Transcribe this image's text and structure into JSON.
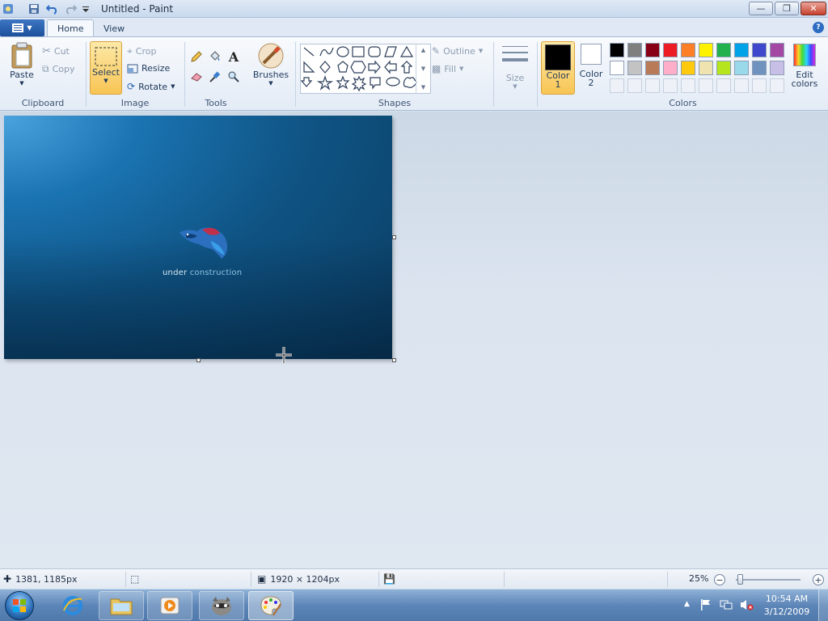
{
  "window": {
    "title": "Untitled - Paint",
    "controls": {
      "minimize_icon": "minimize-icon",
      "maximize_icon": "restore-icon",
      "close_icon": "close-icon"
    }
  },
  "quick_access": [
    "save-icon",
    "undo-icon",
    "redo-icon",
    "customize-dropdown-icon"
  ],
  "tabs": {
    "home": "Home",
    "view": "View"
  },
  "ribbon": {
    "clipboard": {
      "label": "Clipboard",
      "paste": "Paste",
      "cut": "Cut",
      "copy": "Copy"
    },
    "image": {
      "label": "Image",
      "select": "Select",
      "crop": "Crop",
      "resize": "Resize",
      "rotate": "Rotate"
    },
    "tools": {
      "label": "Tools"
    },
    "brushes": {
      "label": "Brushes"
    },
    "shapes": {
      "label": "Shapes",
      "outline": "Outline",
      "fill": "Fill"
    },
    "size": {
      "label": "Size"
    },
    "colors": {
      "label": "Colors",
      "color1_line1": "Color",
      "color1_line2": "1",
      "color2_line1": "Color",
      "color2_line2": "2",
      "edit_line1": "Edit",
      "edit_line2": "colors",
      "color1_value": "#000000",
      "color2_value": "#ffffff",
      "palette_row1": [
        "#000000",
        "#7f7f7f",
        "#880015",
        "#ed1c24",
        "#ff7f27",
        "#fff200",
        "#22b14c",
        "#00a2e8",
        "#3f48cc",
        "#a349a4"
      ],
      "palette_row2": [
        "#ffffff",
        "#c3c3c3",
        "#b97a57",
        "#ffaec9",
        "#ffc90e",
        "#efe4b0",
        "#b5e61d",
        "#99d9ea",
        "#7092be",
        "#c8bfe7"
      ]
    }
  },
  "canvas": {
    "caption_part1": "under",
    "caption_part2": "construction"
  },
  "status": {
    "cursor_pos": "1381, 1185px",
    "image_size": "1920 × 1204px",
    "zoom": "25%"
  },
  "taskbar": {
    "clock_time": "10:54 AM",
    "clock_date": "3/12/2009"
  }
}
